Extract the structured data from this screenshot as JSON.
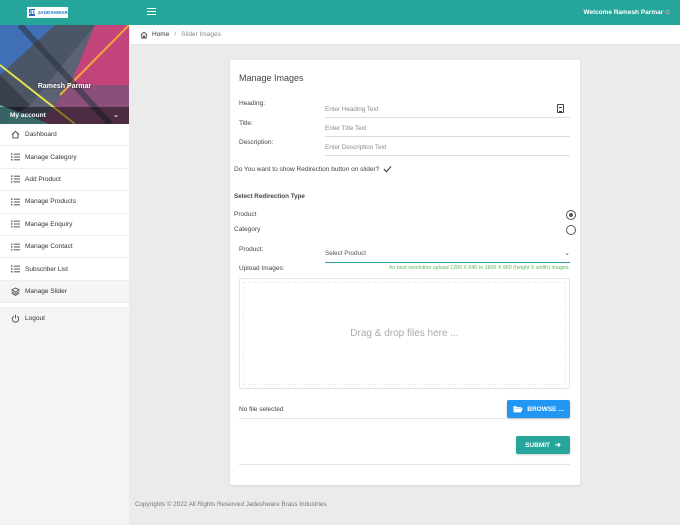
{
  "topbar": {
    "logo_mark": "JB",
    "logo_text": "JADESHWAR",
    "welcome": "Welcome Ramesh Parmar",
    "colors": {
      "primary": "#26a69a",
      "accent": "#2196f3"
    }
  },
  "sidebar": {
    "profile_name": "Ramesh Parmar",
    "account_label": "My account",
    "items": [
      {
        "label": "Dashboard",
        "icon": "home-icon"
      },
      {
        "label": "Manage Category",
        "icon": "list-icon"
      },
      {
        "label": "Add Product",
        "icon": "list-icon"
      },
      {
        "label": "Manage Products",
        "icon": "list-icon"
      },
      {
        "label": "Manage Enquiry",
        "icon": "list-icon"
      },
      {
        "label": "Manage Contact",
        "icon": "list-icon"
      },
      {
        "label": "Subscriber List",
        "icon": "list-icon"
      },
      {
        "label": "Manage Slider",
        "icon": "layers-icon"
      }
    ],
    "logout_label": "Logout"
  },
  "breadcrumb": {
    "home": "Home",
    "separator": "/",
    "current": "Slider Images"
  },
  "form": {
    "title": "Manage Images",
    "heading_label": "Heading:",
    "heading_placeholder": "Enter Heading Text",
    "title_label": "Title:",
    "title_placeholder": "Enter Title Text",
    "description_label": "Description:",
    "description_placeholder": "Enter Description Text",
    "redirect_question": "Do You want to show Redirection button on slider?",
    "redirect_type_label": "Select Redirection Type",
    "options": [
      {
        "label": "Product",
        "checked": true
      },
      {
        "label": "Category",
        "checked": false
      }
    ],
    "product_label": "Product:",
    "product_select": "Select Product",
    "upload_label": "Upload Images:",
    "upload_hint": "for best resolution upload 1200 X 640 to 1800 X 960 (height X width) images.",
    "dropzone_text": "Drag & drop files here ...",
    "file_status": "No file selected",
    "browse_label": "BROWSE ...",
    "submit_label": "SUBMIT"
  },
  "footer": {
    "text": "Copyrights © 2022 All Rights Reserved Jadeshware Brass Industries"
  }
}
